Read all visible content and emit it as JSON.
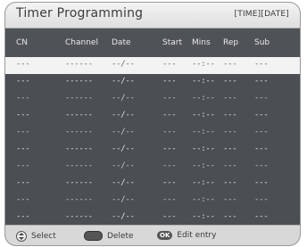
{
  "title": "Timer Programming",
  "mode_label": "[TIME][DATE]",
  "columns": [
    {
      "key": "cn",
      "label": "CN"
    },
    {
      "key": "channel",
      "label": "Channel"
    },
    {
      "key": "date",
      "label": "Date"
    },
    {
      "key": "start",
      "label": "Start"
    },
    {
      "key": "mins",
      "label": "Mins"
    },
    {
      "key": "rep",
      "label": "Rep"
    },
    {
      "key": "sub",
      "label": "Sub"
    }
  ],
  "rows": [
    {
      "cn": "---",
      "channel": "------",
      "date": "--/--",
      "start": "---",
      "mins": "--:--",
      "rep": "---",
      "sub": "---"
    },
    {
      "cn": "---",
      "channel": "------",
      "date": "--/--",
      "start": "---",
      "mins": "--:--",
      "rep": "---",
      "sub": "---"
    },
    {
      "cn": "---",
      "channel": "------",
      "date": "--/--",
      "start": "---",
      "mins": "--:--",
      "rep": "---",
      "sub": "---"
    },
    {
      "cn": "---",
      "channel": "------",
      "date": "--/--",
      "start": "---",
      "mins": "--:--",
      "rep": "---",
      "sub": "---"
    },
    {
      "cn": "---",
      "channel": "------",
      "date": "--/--",
      "start": "---",
      "mins": "--:--",
      "rep": "---",
      "sub": "---"
    },
    {
      "cn": "---",
      "channel": "------",
      "date": "--/--",
      "start": "---",
      "mins": "--:--",
      "rep": "---",
      "sub": "---"
    },
    {
      "cn": "---",
      "channel": "------",
      "date": "--/--",
      "start": "---",
      "mins": "--:--",
      "rep": "---",
      "sub": "---"
    },
    {
      "cn": "---",
      "channel": "------",
      "date": "--/--",
      "start": "---",
      "mins": "--:--",
      "rep": "---",
      "sub": "---"
    },
    {
      "cn": "---",
      "channel": "------",
      "date": "--/--",
      "start": "---",
      "mins": "--:--",
      "rep": "---",
      "sub": "---"
    },
    {
      "cn": "---",
      "channel": "------",
      "date": "--/--",
      "start": "---",
      "mins": "--:--",
      "rep": "---",
      "sub": "---"
    }
  ],
  "selected_row": 0,
  "footer": {
    "select": {
      "icon": "up-down-arrows-icon",
      "label": "Select"
    },
    "delete": {
      "icon": "blue-button-icon",
      "label": "Delete"
    },
    "edit": {
      "icon": "ok-button-icon",
      "icon_text": "OK",
      "label": "Edit entry"
    }
  },
  "colors": {
    "panel": "#4b4f53",
    "selected_row": "#f3f3f3",
    "titlebar": "#e6e6e6",
    "footer": "#d8d8d8"
  }
}
